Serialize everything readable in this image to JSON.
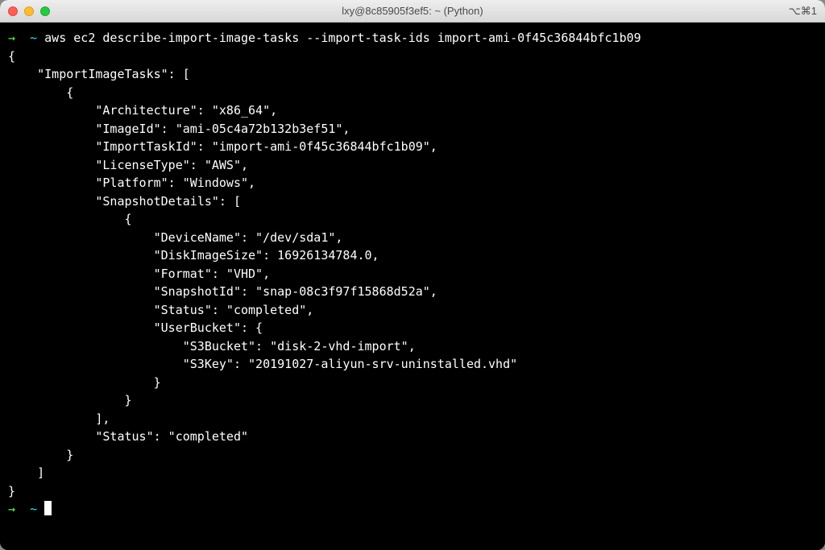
{
  "titlebar": {
    "title": "lxy@8c85905f3ef5: ~ (Python)",
    "shortcut": "⌥⌘1"
  },
  "prompt": {
    "arrow": "→",
    "tilde": "~",
    "command": "aws ec2 describe-import-image-tasks --import-task-ids import-ami-0f45c36844bfc1b09"
  },
  "output": "{\n    \"ImportImageTasks\": [\n        {\n            \"Architecture\": \"x86_64\",\n            \"ImageId\": \"ami-05c4a72b132b3ef51\",\n            \"ImportTaskId\": \"import-ami-0f45c36844bfc1b09\",\n            \"LicenseType\": \"AWS\",\n            \"Platform\": \"Windows\",\n            \"SnapshotDetails\": [\n                {\n                    \"DeviceName\": \"/dev/sda1\",\n                    \"DiskImageSize\": 16926134784.0,\n                    \"Format\": \"VHD\",\n                    \"SnapshotId\": \"snap-08c3f97f15868d52a\",\n                    \"Status\": \"completed\",\n                    \"UserBucket\": {\n                        \"S3Bucket\": \"disk-2-vhd-import\",\n                        \"S3Key\": \"20191027-aliyun-srv-uninstalled.vhd\"\n                    }\n                }\n            ],\n            \"Status\": \"completed\"\n        }\n    ]\n}",
  "prompt2": {
    "arrow": "→",
    "tilde": "~"
  }
}
